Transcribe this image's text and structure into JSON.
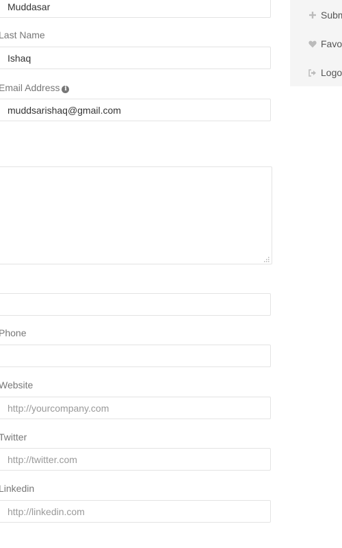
{
  "form": {
    "first_name_value": "Muddasar",
    "last_name_label": "Last Name",
    "last_name_value": "Ishaq",
    "email_label": "Email Address",
    "email_value": "muddsarishaq@gmail.com",
    "phone_label": "Phone",
    "website_label": "Website",
    "website_placeholder": "http://yourcompany.com",
    "twitter_label": "Twitter",
    "twitter_placeholder": "http://twitter.com",
    "linkedin_label": "Linkedin",
    "linkedin_placeholder": "http://linkedin.com"
  },
  "sidebar": {
    "items": [
      {
        "label": "Subm",
        "icon": "plus-icon"
      },
      {
        "label": "Favo",
        "icon": "heart-icon"
      },
      {
        "label": "Logo",
        "icon": "logout-icon"
      }
    ]
  },
  "colors": {
    "border": "#e3e3e3",
    "label": "#777777",
    "sidebar_bg": "#f5f5f5",
    "icon": "#bbbbbb"
  }
}
